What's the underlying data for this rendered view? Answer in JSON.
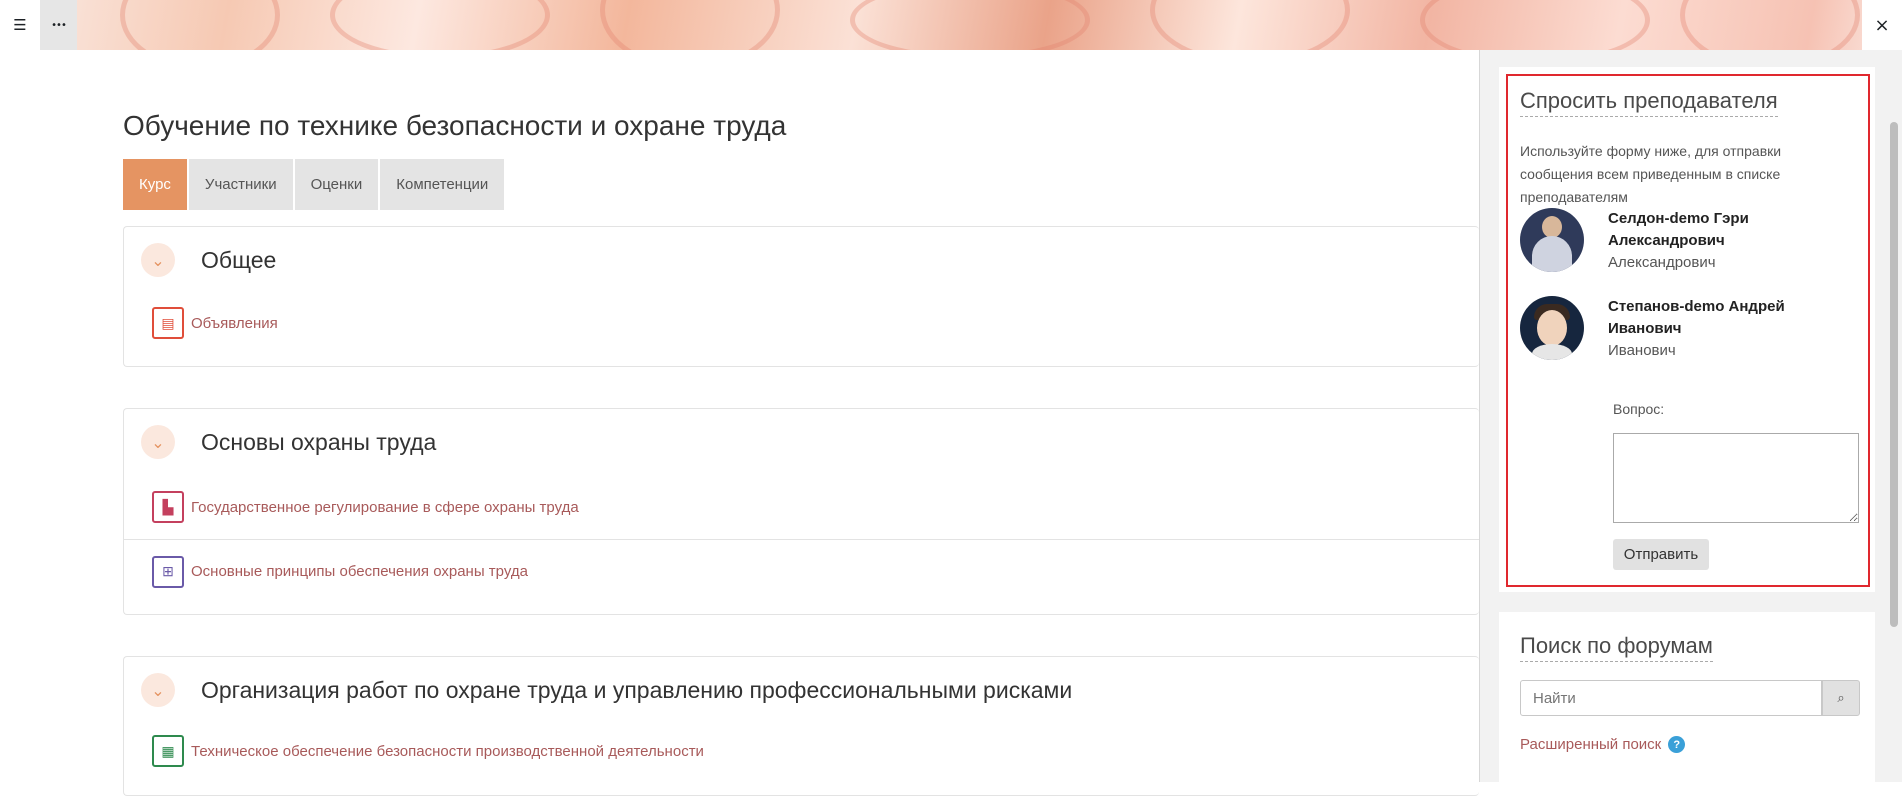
{
  "toolbar": {
    "index_icon": "☰",
    "more_icon": "•••",
    "close_icon": "×"
  },
  "course": {
    "title": "Обучение по технике безопасности и охране труда",
    "tabs": [
      {
        "label": "Курс",
        "active": true
      },
      {
        "label": "Участники"
      },
      {
        "label": "Оценки"
      },
      {
        "label": "Компетенции"
      }
    ]
  },
  "sections": [
    {
      "title": "Общее",
      "activities": [
        {
          "label": "Объявления",
          "icon": "forum-icon",
          "color": "#e04e3a"
        }
      ]
    },
    {
      "title": "Основы охраны труда",
      "activities": [
        {
          "label": "Государственное регулирование в сфере охраны труда",
          "icon": "file-icon",
          "color": "#c4405e"
        },
        {
          "label": "Основные принципы обеспечения охраны труда",
          "icon": "hierarchy-icon",
          "color": "#6a5aa8"
        }
      ]
    },
    {
      "title": "Организация работ по охране труда и управлению профессиональными рисками",
      "activities": [
        {
          "label": "Техническое обеспечение безопасности производственной деятельности",
          "icon": "book-icon",
          "color": "#2e8a4e"
        }
      ]
    }
  ],
  "ask_teacher": {
    "title": "Спросить преподавателя",
    "description": "Используйте форму ниже, для отправки сообщения всем приведенным в списке преподавателям",
    "teachers": [
      {
        "name": "Селдон-demo Гэри Александрович",
        "sub": "Александрович"
      },
      {
        "name": "Степанов-demo Андрей Иванович",
        "sub": "Иванович"
      }
    ],
    "question_label": "Вопрос:",
    "send_label": "Отправить"
  },
  "forum_search": {
    "title": "Поиск по форумам",
    "placeholder": "Найти",
    "advanced": "Расширенный поиск",
    "help_icon": "?"
  }
}
